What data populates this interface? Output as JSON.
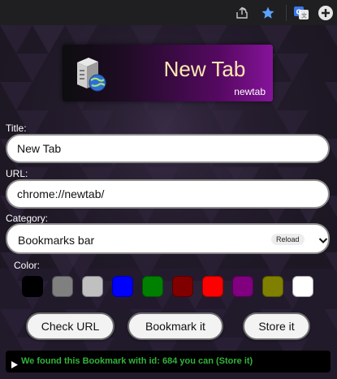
{
  "popup": {
    "banner": {
      "title": "New Tab",
      "subtitle": "newtab",
      "icon": "server-globe-icon"
    },
    "title_label": "Title:",
    "title_value": "New Tab",
    "url_label": "URL:",
    "url_value": "chrome://newtab/",
    "category_label": "Category:",
    "category_value": "Bookmarks bar",
    "reload_label": "Reload",
    "color_label": "Color:",
    "colors": [
      "#000000",
      "#808080",
      "#c0c0c0",
      "#0000ff",
      "#008000",
      "#800000",
      "#ff0000",
      "#800080",
      "#808000",
      "#ffffff"
    ],
    "buttons": {
      "check_url": "Check URL",
      "bookmark_it": "Bookmark it",
      "store_it": "Store it"
    },
    "status_message": "We found this Bookmark with id: 684 you can (Store it)"
  },
  "theme": {
    "accent_star": "#5aa4ff",
    "status_green": "#30b43a",
    "banner_purple": "#86139a"
  }
}
